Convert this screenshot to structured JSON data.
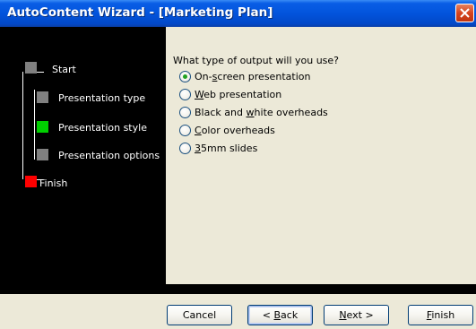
{
  "window": {
    "title": "AutoContent Wizard - [Marketing Plan]"
  },
  "steps": [
    {
      "label": "Start",
      "color": "#808080"
    },
    {
      "label": "Presentation type",
      "color": "#808080"
    },
    {
      "label": "Presentation style",
      "color": "#00d000"
    },
    {
      "label": "Presentation options",
      "color": "#808080"
    },
    {
      "label": "Finish",
      "color": "#ff0000"
    }
  ],
  "question": "What type of output will you use?",
  "options": [
    {
      "label": "On-screen presentation",
      "mnemonic_index": 3,
      "selected": true
    },
    {
      "label": "Web presentation",
      "mnemonic_index": 0,
      "selected": false
    },
    {
      "label": "Black and white overheads",
      "mnemonic_index": 10,
      "selected": false
    },
    {
      "label": "Color overheads",
      "mnemonic_index": 0,
      "selected": false
    },
    {
      "label": "35mm slides",
      "mnemonic_index": 0,
      "selected": false
    }
  ],
  "buttons": {
    "cancel": "Cancel",
    "back": "< Back",
    "next": "Next >",
    "finish": "Finish"
  },
  "colors": {
    "titlebar": "#0254dc",
    "selected_radio": "#21a121"
  }
}
